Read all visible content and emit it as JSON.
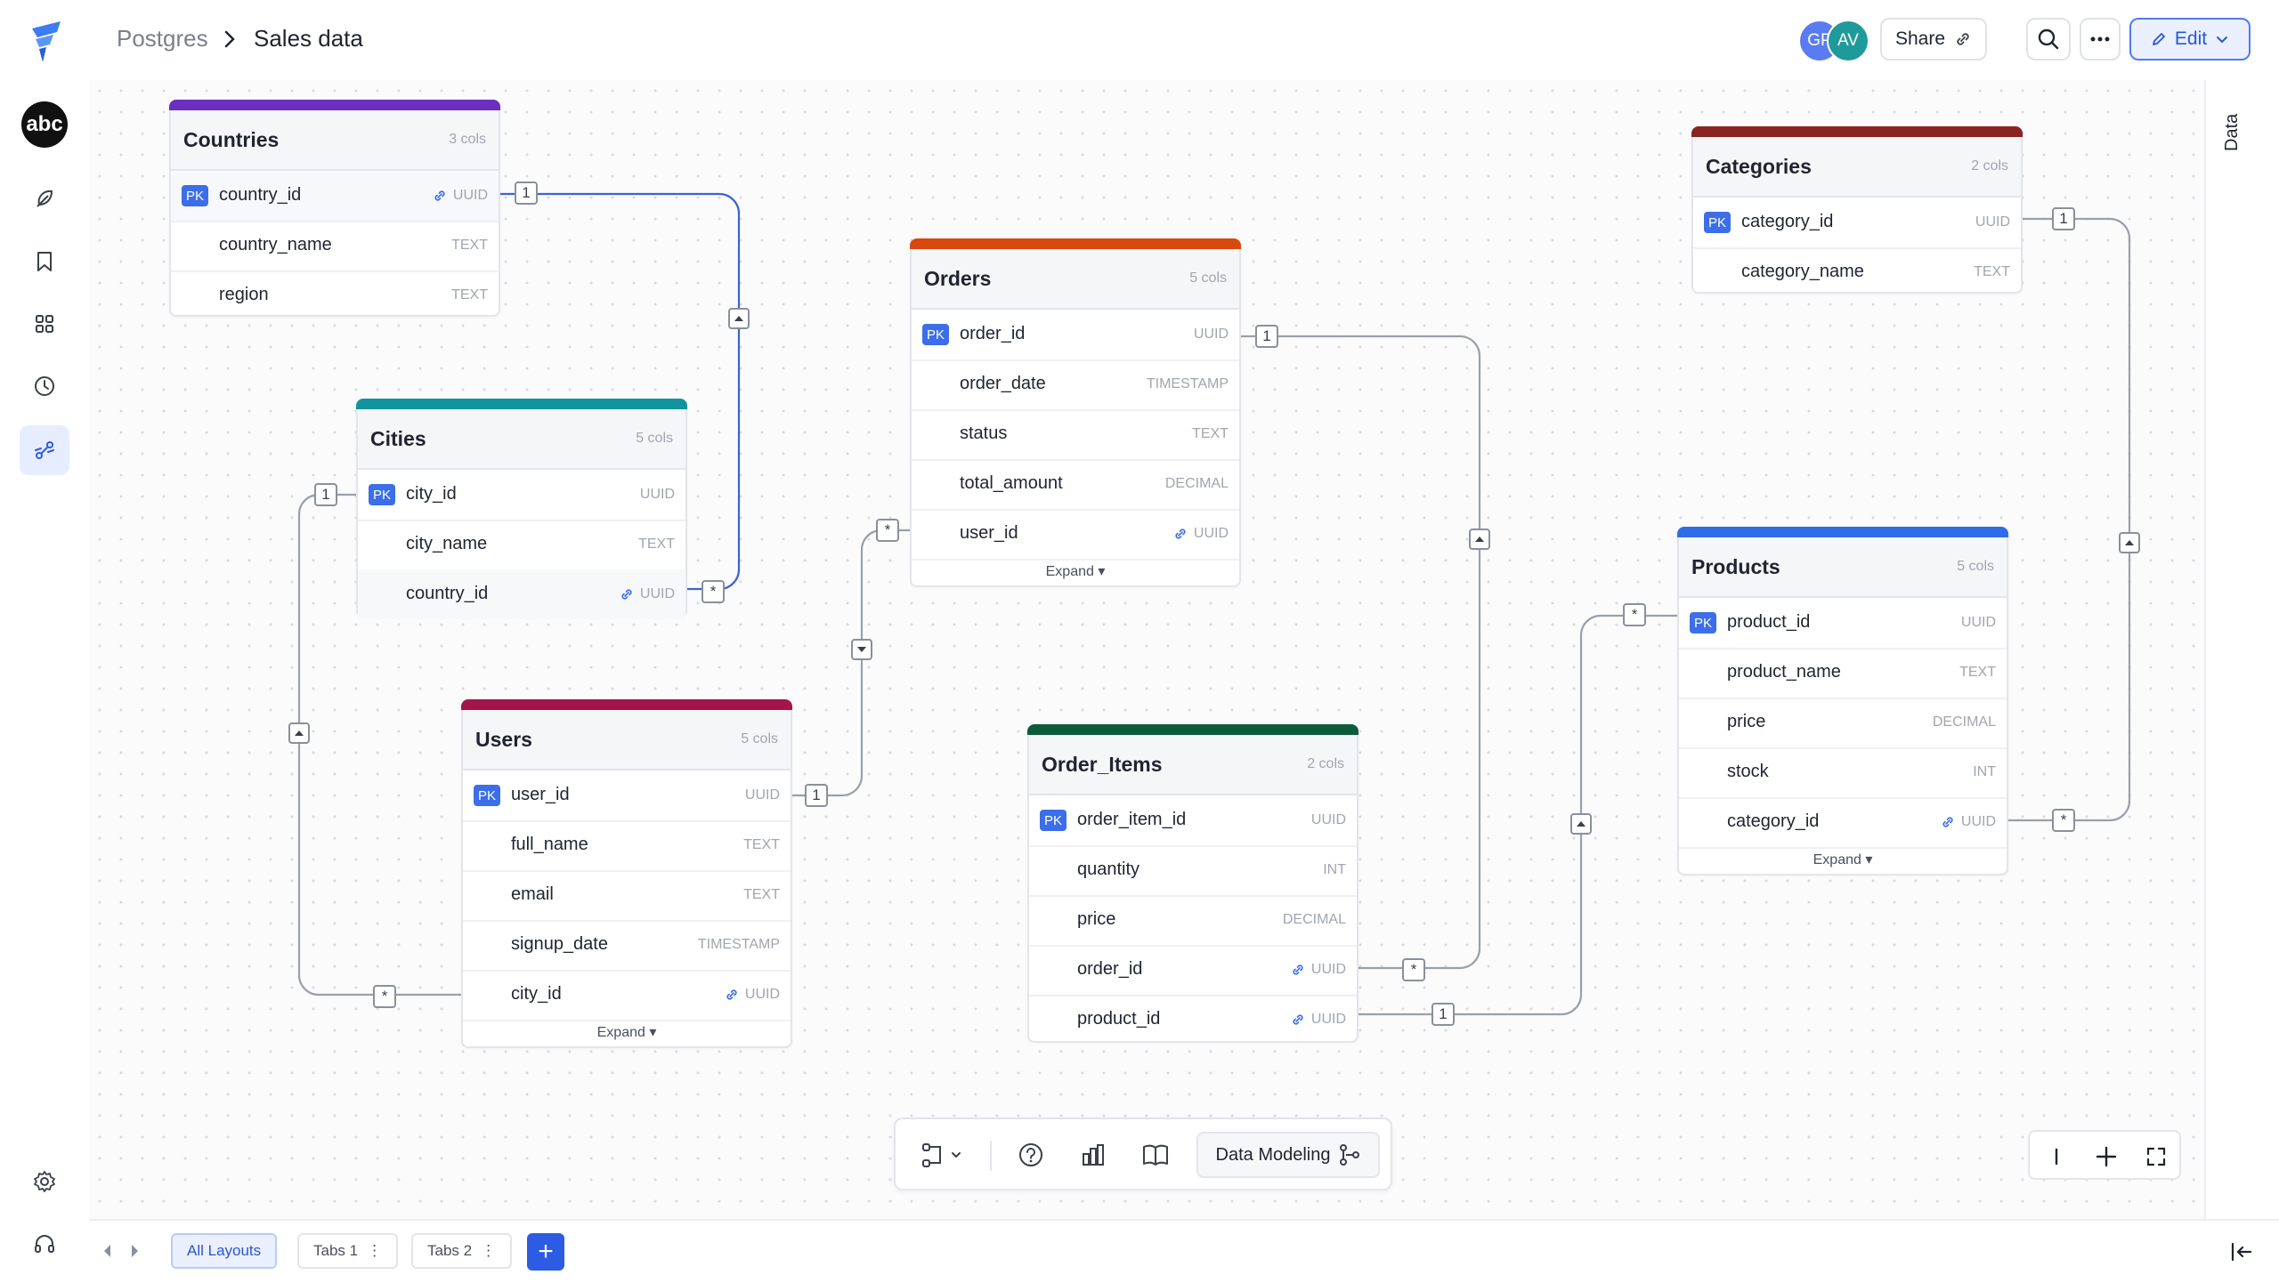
{
  "breadcrumb": {
    "root": "Postgres",
    "page": "Sales data"
  },
  "header": {
    "avatars": [
      "GP",
      "AV"
    ],
    "share_label": "Share",
    "edit_label": "Edit"
  },
  "right_panel": {
    "label": "Data"
  },
  "workspace": {
    "logo_text": "abc"
  },
  "tables": {
    "countries": {
      "name": "Countries",
      "cols": "3 cols",
      "columns": [
        {
          "name": "country_id",
          "type": "UUID",
          "pk": "PK"
        },
        {
          "name": "country_name",
          "type": "TEXT"
        },
        {
          "name": "region",
          "type": "TEXT"
        }
      ]
    },
    "cities": {
      "name": "Cities",
      "cols": "5 cols",
      "columns": [
        {
          "name": "city_id",
          "type": "UUID",
          "pk": "PK"
        },
        {
          "name": "city_name",
          "type": "TEXT"
        },
        {
          "name": "country_id",
          "type": "UUID"
        }
      ]
    },
    "orders": {
      "name": "Orders",
      "cols": "5 cols",
      "columns": [
        {
          "name": "order_id",
          "type": "UUID",
          "pk": "PK"
        },
        {
          "name": "order_date",
          "type": "TIMESTAMP"
        },
        {
          "name": "status",
          "type": "TEXT"
        },
        {
          "name": "total_amount",
          "type": "DECIMAL"
        },
        {
          "name": "user_id",
          "type": "UUID"
        }
      ],
      "expand": "Expand"
    },
    "users": {
      "name": "Users",
      "cols": "5 cols",
      "columns": [
        {
          "name": "user_id",
          "type": "UUID",
          "pk": "PK"
        },
        {
          "name": "full_name",
          "type": "TEXT"
        },
        {
          "name": "email",
          "type": "TEXT"
        },
        {
          "name": "signup_date",
          "type": "TIMESTAMP"
        },
        {
          "name": "city_id",
          "type": "UUID"
        }
      ],
      "expand": "Expand"
    },
    "order_items": {
      "name": "Order_Items",
      "cols": "2 cols",
      "columns": [
        {
          "name": "order_item_id",
          "type": "UUID",
          "pk": "PK"
        },
        {
          "name": "quantity",
          "type": "INT"
        },
        {
          "name": "price",
          "type": "DECIMAL"
        },
        {
          "name": "order_id",
          "type": "UUID"
        },
        {
          "name": "product_id",
          "type": "UUID"
        }
      ]
    },
    "categories": {
      "name": "Categories",
      "cols": "2 cols",
      "columns": [
        {
          "name": "category_id",
          "type": "UUID",
          "pk": "PK"
        },
        {
          "name": "category_name",
          "type": "TEXT"
        }
      ]
    },
    "products": {
      "name": "Products",
      "cols": "5 cols",
      "columns": [
        {
          "name": "product_id",
          "type": "UUID",
          "pk": "PK"
        },
        {
          "name": "product_name",
          "type": "TEXT"
        },
        {
          "name": "price",
          "type": "DECIMAL"
        },
        {
          "name": "stock",
          "type": "INT"
        },
        {
          "name": "category_id",
          "type": "UUID"
        }
      ],
      "expand": "Expand"
    }
  },
  "markers": {
    "one": "1",
    "many": "*"
  },
  "toolbar": {
    "data_modeling": "Data Modeling"
  },
  "tabs": {
    "all_layouts": "All Layouts",
    "tab1": "Tabs 1",
    "tab2": "Tabs 2"
  },
  "colors": {
    "countries": "#6a2fbf",
    "cities": "#12949c",
    "orders": "#d9480f",
    "users": "#a3154a",
    "order_items": "#0c5c3c",
    "categories": "#8a2424",
    "products": "#2f6de8",
    "accent": "#2d5be3"
  },
  "icons": {
    "logo": "brand-logo-icon",
    "rail": [
      "feather-icon",
      "bookmark-icon",
      "grid-icon",
      "clock-icon",
      "relationship-icon",
      "settings-icon",
      "headset-icon"
    ]
  }
}
